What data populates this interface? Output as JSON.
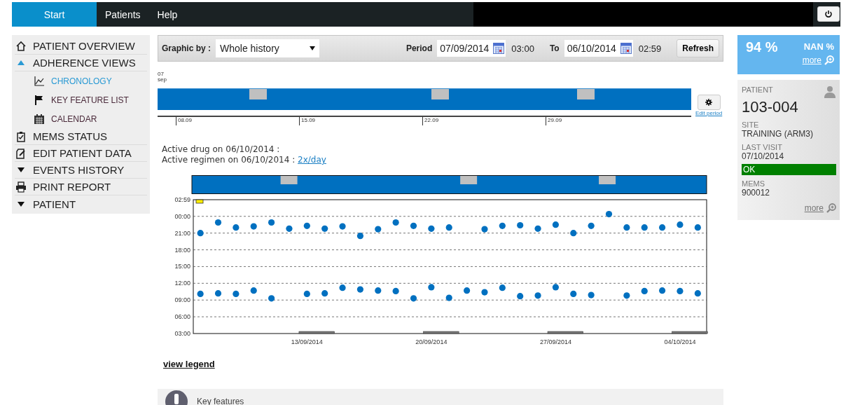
{
  "nav": {
    "tabs": [
      {
        "label": "Start",
        "selected": true
      },
      {
        "label": "Patients",
        "selected": false
      },
      {
        "label": "Help",
        "selected": false
      }
    ]
  },
  "sidebar": {
    "items": [
      {
        "label": "PATIENT OVERVIEW"
      },
      {
        "label": "ADHERENCE VIEWS",
        "expanded": true,
        "children": [
          {
            "label": "CHRONOLOGY",
            "selected": true
          },
          {
            "label": "KEY FEATURE LIST",
            "selected": false
          },
          {
            "label": "CALENDAR",
            "selected": false
          }
        ]
      },
      {
        "label": "MEMS STATUS"
      },
      {
        "label": "EDIT PATIENT DATA"
      },
      {
        "label": "EVENTS HISTORY",
        "expanded": false
      },
      {
        "label": "PRINT REPORT"
      },
      {
        "label": "PATIENT",
        "expanded": false
      }
    ]
  },
  "toolbar": {
    "graphic_by_label": "Graphic by :",
    "graphic_by_value": "Whole history",
    "period_label": "Period",
    "from_date": "07/09/2014",
    "from_time": "03:00",
    "to_label": "To",
    "to_date": "06/10/2014",
    "to_time": "02:59",
    "refresh": "Refresh"
  },
  "timeline": {
    "start_day": "07",
    "start_month": "sep",
    "ticks": [
      "08.09",
      "15.09",
      "22.09",
      "29.09"
    ],
    "edit_link": "Edit period"
  },
  "active_drug": "Active drug on 06/10/2014 :",
  "active_regimen": "Active regimen on 06/10/2014 :",
  "regimen_link": "2x/day",
  "chart_data": {
    "type": "scatter",
    "grid": true,
    "categories": [
      null,
      null,
      null,
      null,
      null,
      null,
      "13/09/2014",
      null,
      null,
      null,
      null,
      null,
      null,
      "20/09/2014",
      null,
      null,
      null,
      null,
      null,
      null,
      "27/09/2014",
      null,
      null,
      null,
      null,
      null,
      null,
      "04/10/2014",
      null
    ],
    "series": [
      {
        "color": "#0070c0",
        "values": [
          21.0,
          22.9,
          22.0,
          22.2,
          22.9,
          21.8,
          22.3,
          21.8,
          22.2,
          20.5,
          21.7,
          22.9,
          22.3,
          21.8,
          22.0,
          null,
          21.7,
          22.3,
          22.4,
          21.8,
          22.5,
          21.0,
          22.3,
          24.4,
          22.0,
          22.0,
          22.0,
          22.5,
          22.0
        ]
      },
      {
        "color": "#0070c0",
        "values": [
          10.1,
          10.2,
          10.1,
          10.7,
          9.3,
          null,
          10.1,
          10.2,
          11.2,
          10.9,
          10.7,
          10.6,
          9.3,
          11.3,
          9.4,
          10.7,
          10.4,
          11.2,
          9.7,
          9.8,
          11.3,
          10.1,
          9.9,
          null,
          9.8,
          10.6,
          10.7,
          10.6,
          10.2
        ]
      }
    ],
    "ylim": [
      3,
      26.9833
    ],
    "yticks": [
      {
        "value": 3,
        "label": "03:00"
      },
      {
        "value": 6,
        "label": "06:00"
      },
      {
        "value": 9,
        "label": "09:00"
      },
      {
        "value": 12,
        "label": "12:00"
      },
      {
        "value": 15,
        "label": "15:00"
      },
      {
        "value": 18,
        "label": "18:00"
      },
      {
        "value": 21,
        "label": "21:00"
      },
      {
        "value": 24,
        "label": "00:00"
      },
      {
        "label": "02:59"
      }
    ]
  },
  "view_legend": "view legend",
  "key_features": "Key features",
  "adherence": {
    "value": "94 %",
    "secondary": "NAN %",
    "more": "more"
  },
  "patient": {
    "label": "PATIENT",
    "id": "103-004",
    "fields": [
      {
        "label": "SITE",
        "value": "TRAINING (ARM3)"
      },
      {
        "label": "LAST VISIT",
        "value": "07/10/2014"
      }
    ],
    "status": "OK",
    "mems_label": "MEMS",
    "mems_value": "900012",
    "more": "more"
  }
}
